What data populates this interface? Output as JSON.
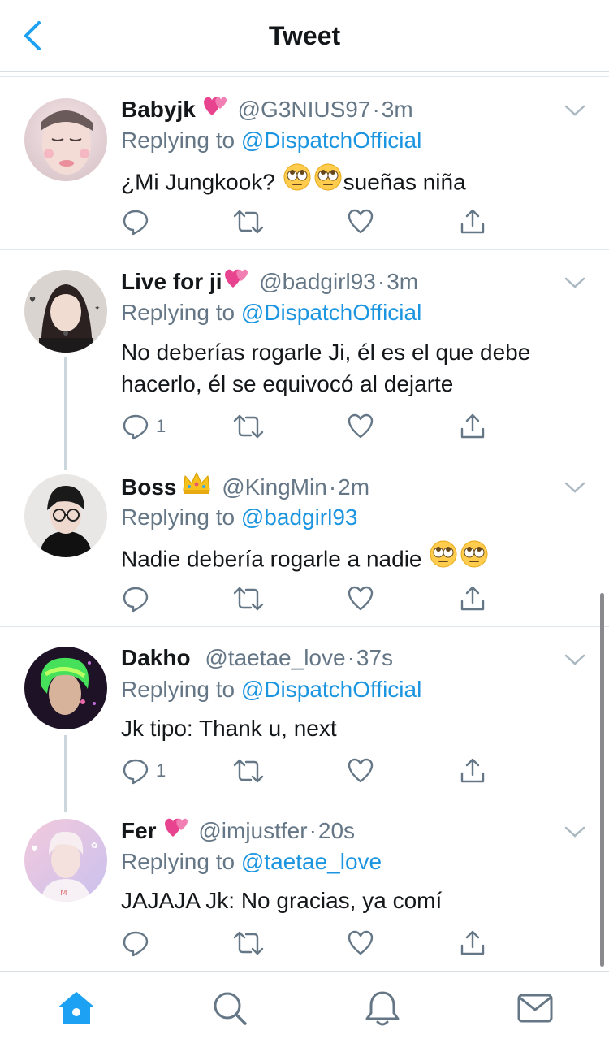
{
  "header": {
    "title": "Tweet"
  },
  "tweets": [
    {
      "name": "Babyjk",
      "handle": "@G3NIUS97",
      "time": "3m",
      "replying_prefix": "Replying to",
      "replying_to": "@DispatchOfficial",
      "text_before": "¿Mi Jungkook?",
      "text_after": "sueñas niña",
      "reply_count": ""
    },
    {
      "name": "Live for ji",
      "handle": "@badgirl93",
      "time": "3m",
      "replying_prefix": "Replying to",
      "replying_to": "@DispatchOfficial",
      "text": "No deberías rogarle Ji, él es el que debe hacerlo, él se equivocó al dejarte",
      "reply_count": "1"
    },
    {
      "name": "Boss",
      "handle": "@KingMin",
      "time": "2m",
      "replying_prefix": "Replying to",
      "replying_to": "@badgirl93",
      "text": "Nadie debería rogarle a nadie",
      "reply_count": ""
    },
    {
      "name": "Dakho",
      "handle": "@taetae_love",
      "time": "37s",
      "replying_prefix": "Replying to",
      "replying_to": "@DispatchOfficial",
      "text": "Jk tipo: Thank u, next",
      "reply_count": "1"
    },
    {
      "name": "Fer",
      "handle": "@imjustfer",
      "time": "20s",
      "replying_prefix": "Replying to",
      "replying_to": "@taetae_love",
      "text": "JAJAJA Jk: No gracias, ya comí",
      "reply_count": ""
    }
  ],
  "icons": {
    "back": "chevron-left-icon",
    "reply": "reply-bubble-icon",
    "retweet": "retweet-icon",
    "like": "heart-icon",
    "share": "share-icon",
    "caret": "chevron-down-icon",
    "tabs": [
      "home-icon",
      "search-icon",
      "notifications-icon",
      "messages-icon"
    ]
  },
  "colors": {
    "accent": "#1da1f2",
    "link": "#1b95e0",
    "secondary": "#657786",
    "divider": "#e1e8ed"
  }
}
